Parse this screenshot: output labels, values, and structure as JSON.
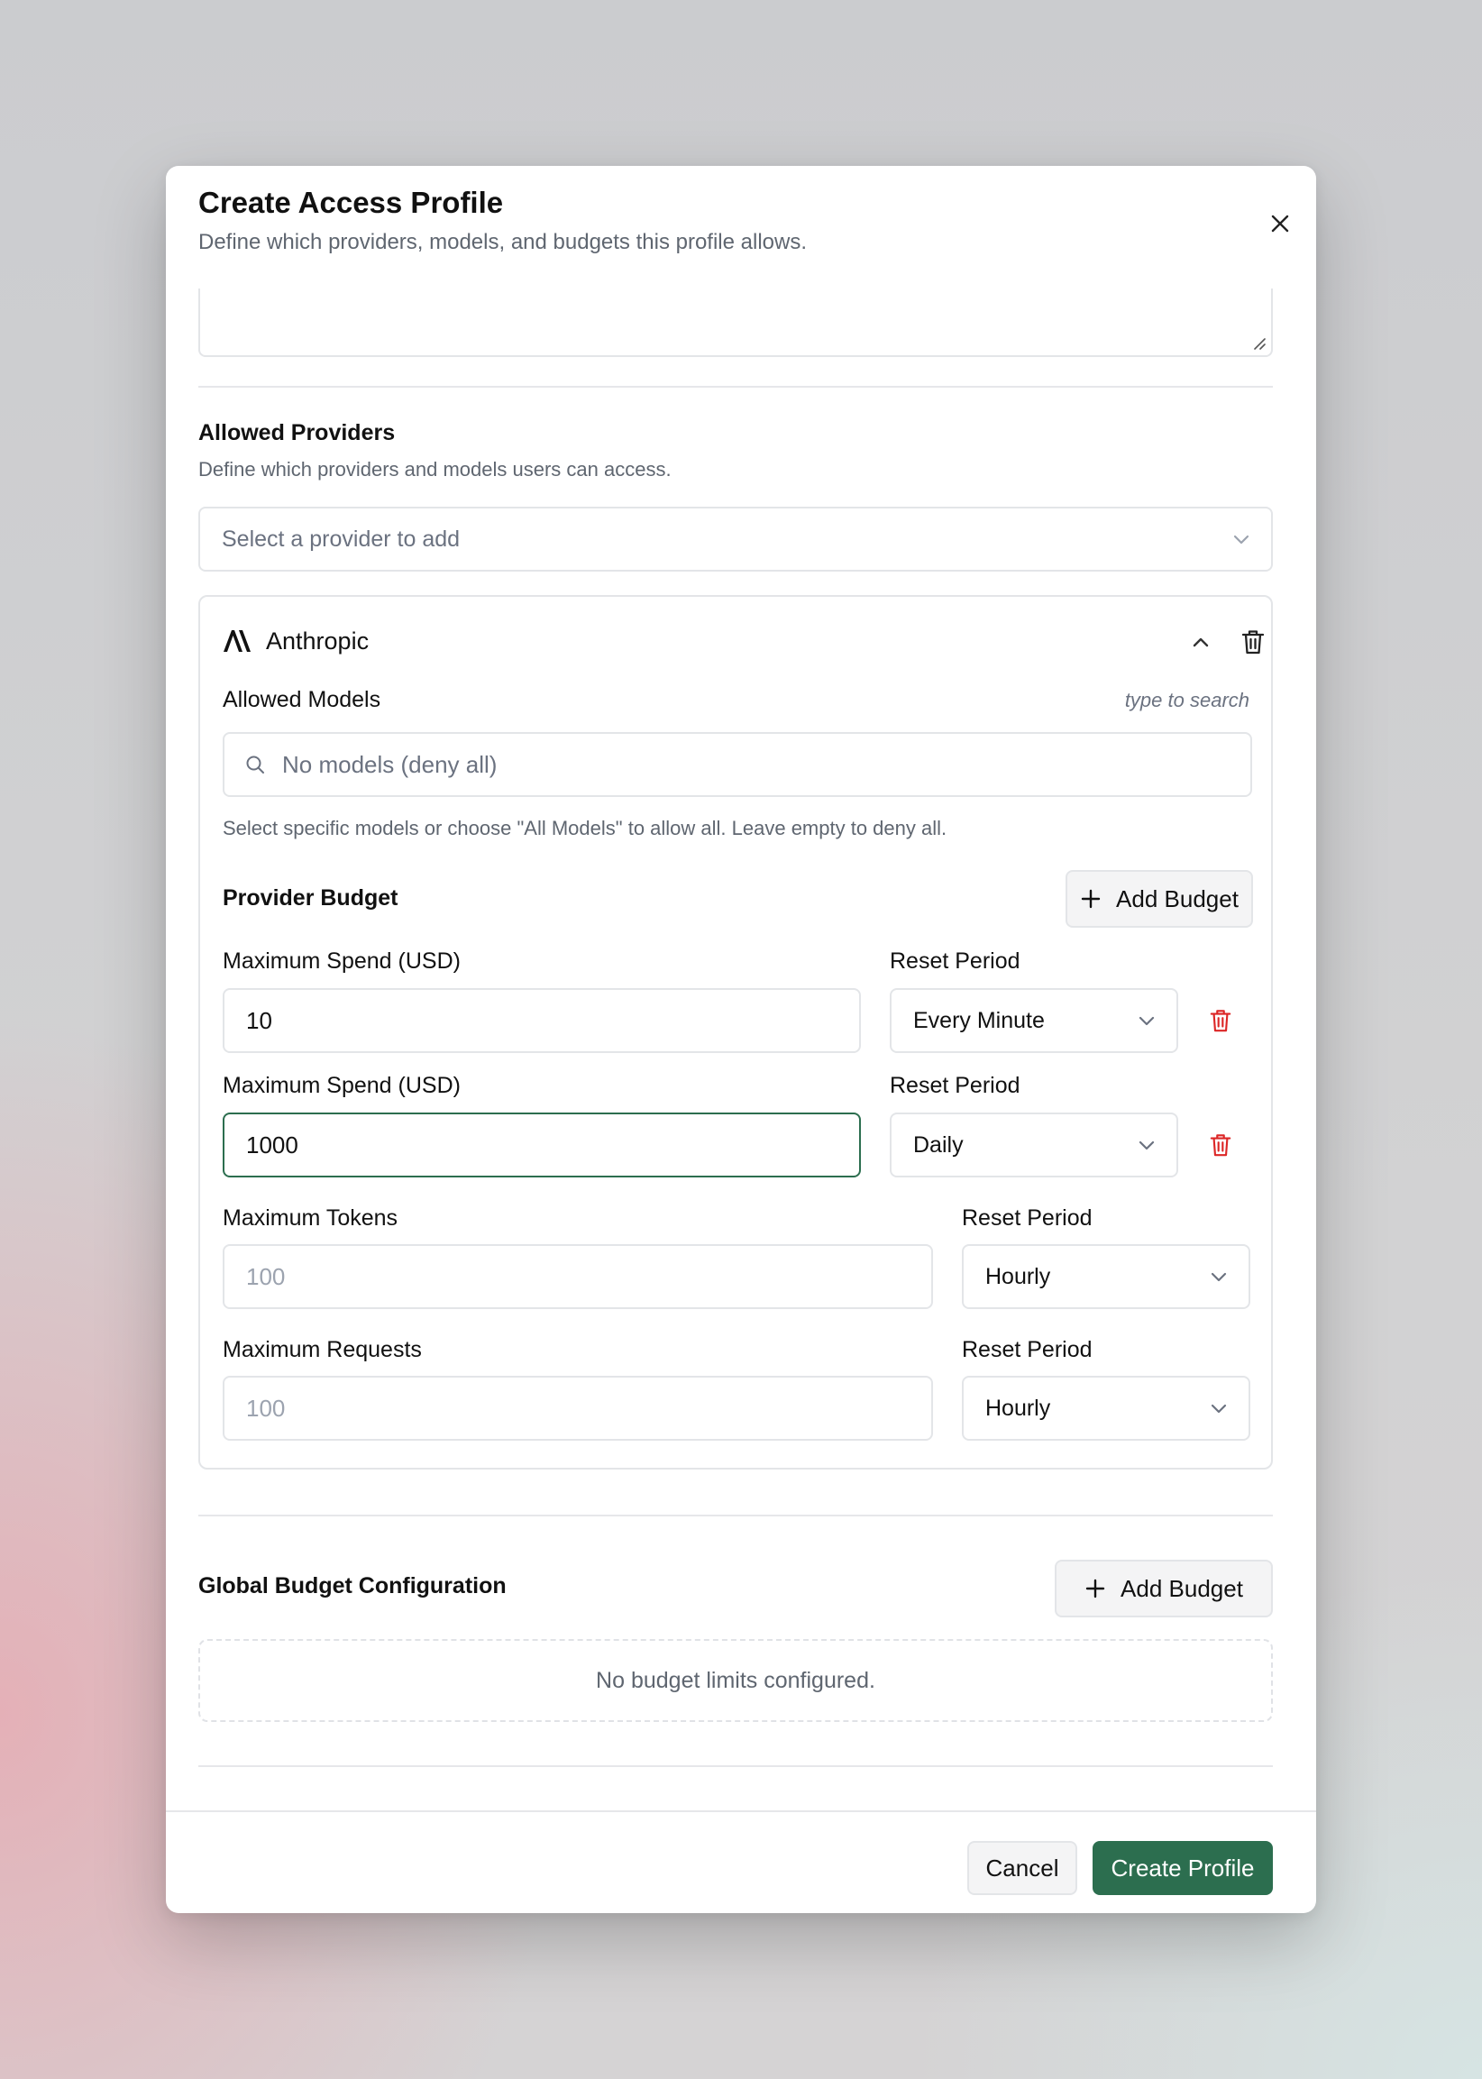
{
  "dialog": {
    "title": "Create Access Profile",
    "subtitle": "Define which providers, models, and budgets this profile allows."
  },
  "providers": {
    "title": "Allowed Providers",
    "description": "Define which providers and models users can access.",
    "select_placeholder": "Select a provider to add"
  },
  "provider_card": {
    "name": "Anthropic",
    "models_label": "Allowed Models",
    "models_hint": "type to search",
    "models_placeholder": "No models (deny all)",
    "models_help": "Select specific models or choose \"All Models\" to allow all. Leave empty to deny all.",
    "budget_label": "Provider Budget",
    "add_budget_label": "Add Budget",
    "spend_rows": [
      {
        "label": "Maximum Spend (USD)",
        "value": "10",
        "period_label": "Reset Period",
        "period": "Every Minute"
      },
      {
        "label": "Maximum Spend (USD)",
        "value": "1000",
        "period_label": "Reset Period",
        "period": "Daily"
      }
    ],
    "tokens": {
      "label": "Maximum Tokens",
      "placeholder": "100",
      "period_label": "Reset Period",
      "period": "Hourly"
    },
    "requests": {
      "label": "Maximum Requests",
      "placeholder": "100",
      "period_label": "Reset Period",
      "period": "Hourly"
    }
  },
  "global_budget": {
    "title": "Global Budget Configuration",
    "add_budget_label": "Add Budget",
    "empty_text": "No budget limits configured."
  },
  "footer": {
    "cancel_label": "Cancel",
    "create_label": "Create Profile"
  },
  "colors": {
    "primary": "#2c6e4f",
    "danger": "#dc2626",
    "border": "#e3e5e8",
    "muted_text": "#5f6670"
  },
  "icons": [
    "close-icon",
    "chevron-down-icon",
    "chevron-up-icon",
    "trash-icon",
    "search-icon",
    "plus-icon",
    "anthropic-logo"
  ]
}
